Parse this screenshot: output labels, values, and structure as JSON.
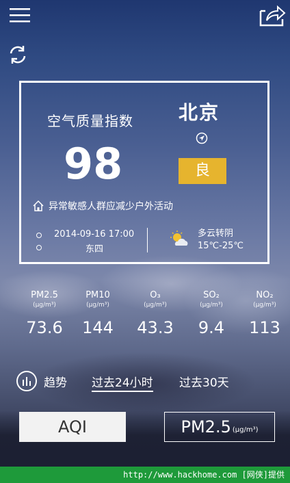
{
  "header": {
    "menu_icon": "menu-icon",
    "share_icon": "share-icon",
    "refresh_icon": "refresh-icon"
  },
  "card": {
    "aqi_title": "空气质量指数",
    "aqi_value": "98",
    "city": "北京",
    "level": "良",
    "level_color": "#e6b42e",
    "advice": "异常敏感人群应减少户外活动",
    "datetime": "2014-09-16 17:00",
    "station": "东四",
    "weather": "多云转阴",
    "temperature": "15℃-25℃"
  },
  "pollutants": [
    {
      "name": "PM2.5",
      "unit": "(μg/m³)",
      "value": "73.6"
    },
    {
      "name": "PM10",
      "unit": "(μg/m³)",
      "value": "144"
    },
    {
      "name": "O₃",
      "unit": "(μg/m³)",
      "value": "43.3"
    },
    {
      "name": "SO₂",
      "unit": "(μg/m³)",
      "value": "9.4"
    },
    {
      "name": "NO₂",
      "unit": "(μg/m³)",
      "value": "113"
    }
  ],
  "trend": {
    "label": "趋势",
    "tab_24h": "过去24小时",
    "tab_30d": "过去30天"
  },
  "buttons": {
    "aqi": "AQI",
    "pm_main": "PM2.5",
    "pm_unit": "(μg/m³)"
  },
  "footer": {
    "text": "http://www.hackhome.com [网侠]提供"
  }
}
